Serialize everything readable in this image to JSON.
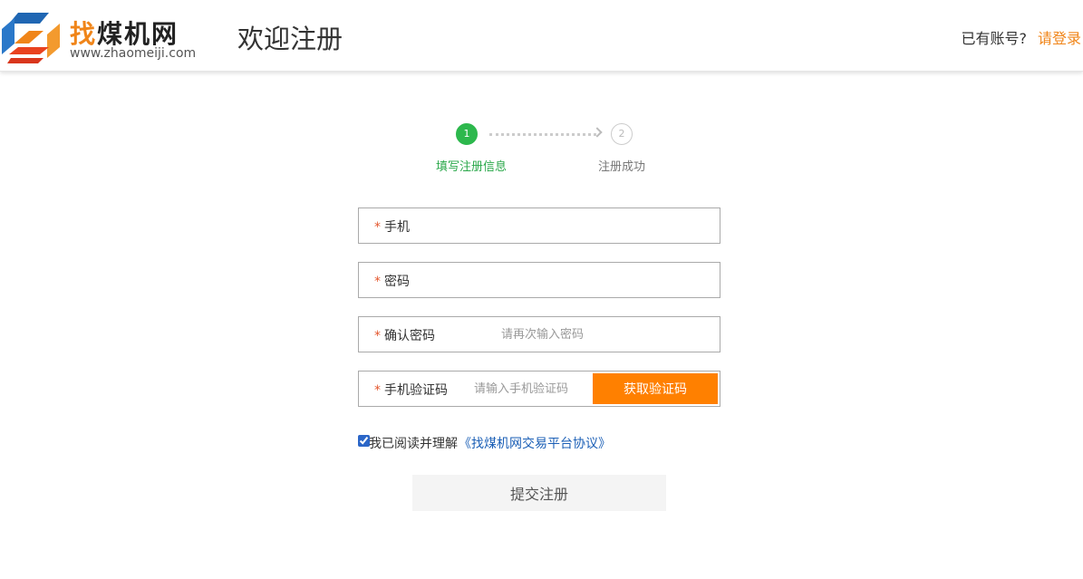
{
  "header": {
    "logo_name_first": "找",
    "logo_name_rest": "煤机网",
    "logo_url": "www.zhaomeiji.com",
    "page_title": "欢迎注册",
    "account_question": "已有账号?",
    "login_link": "请登录"
  },
  "colors": {
    "brand_orange": "#f08519",
    "brand_blue": "#1f66b3",
    "step_active": "#2db84d",
    "button_orange": "#ff8000"
  },
  "steps": [
    {
      "number": "1",
      "label": "填写注册信息",
      "state": "active"
    },
    {
      "number": "2",
      "label": "注册成功",
      "state": "inactive"
    }
  ],
  "form": {
    "required_mark": "*",
    "phone": {
      "label": "手机",
      "value": "",
      "placeholder": ""
    },
    "password": {
      "label": "密码",
      "value": "",
      "placeholder": ""
    },
    "confirm_password": {
      "label": "确认密码",
      "value": "",
      "placeholder": "请再次输入密码"
    },
    "sms_code": {
      "label": "手机验证码",
      "value": "",
      "placeholder": "请输入手机验证码",
      "button_label": "获取验证码"
    },
    "agreement": {
      "checked": true,
      "text": "我已阅读并理解",
      "link_text": "《找煤机网交易平台协议》"
    },
    "submit_label": "提交注册"
  },
  "icons": {
    "logo": "zhaomeiji-logo-icon",
    "arrow": "chevron-right-icon"
  }
}
